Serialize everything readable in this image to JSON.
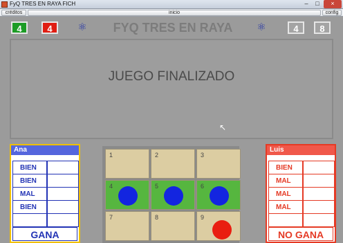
{
  "window": {
    "title": "FyQ TRES EN RAYA FICH",
    "min": "–",
    "max": "□",
    "close": "×"
  },
  "menu": {
    "creditos": "créditos",
    "inicio": "inicio",
    "config": "config"
  },
  "score": {
    "green": "4",
    "red": "4",
    "gray1": "4",
    "gray2": "8",
    "title": "FYQ TRES EN RAYA"
  },
  "message": "JUEGO FINALIZADO",
  "players": {
    "ana": {
      "name": "Ana",
      "rows": [
        "BIEN",
        "BIEN",
        "MAL",
        "BIEN",
        ""
      ],
      "result": "GANA"
    },
    "luis": {
      "name": "Luis",
      "rows": [
        "BIEN",
        "MAL",
        "MAL",
        "MAL",
        ""
      ],
      "result": "NO GANA"
    }
  },
  "board": {
    "cells": [
      {
        "n": "1",
        "piece": ""
      },
      {
        "n": "2",
        "piece": ""
      },
      {
        "n": "3",
        "piece": ""
      },
      {
        "n": "4",
        "piece": "blue"
      },
      {
        "n": "5",
        "piece": "blue"
      },
      {
        "n": "6",
        "piece": "blue"
      },
      {
        "n": "7",
        "piece": ""
      },
      {
        "n": "8",
        "piece": ""
      },
      {
        "n": "9",
        "piece": "red"
      }
    ],
    "winning_row": 1
  },
  "colors": {
    "green": "#1c9c25",
    "red": "#e01d12",
    "blue": "#1325e0",
    "winning": "#56b63f"
  }
}
